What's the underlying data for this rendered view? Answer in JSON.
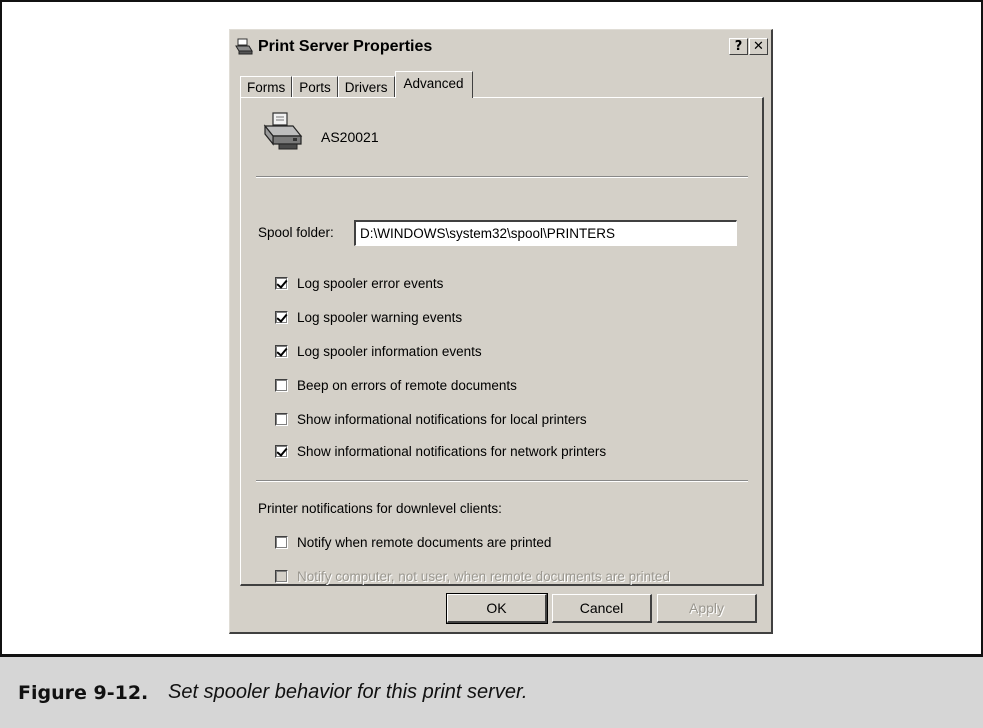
{
  "dialog": {
    "title": "Print Server Properties",
    "help_button": "?",
    "close_button": "✕"
  },
  "tabs": [
    {
      "label": "Forms",
      "active": false
    },
    {
      "label": "Ports",
      "active": false
    },
    {
      "label": "Drivers",
      "active": false
    },
    {
      "label": "Advanced",
      "active": true
    }
  ],
  "server": {
    "icon": "printer-icon",
    "name": "AS20021"
  },
  "spool": {
    "label": "Spool folder:",
    "value": "D:\\WINDOWS\\system32\\spool\\PRINTERS"
  },
  "options": [
    {
      "label": "Log spooler error events",
      "checked": true,
      "enabled": true
    },
    {
      "label": "Log spooler warning events",
      "checked": true,
      "enabled": true
    },
    {
      "label": "Log spooler information events",
      "checked": true,
      "enabled": true
    },
    {
      "label": "Beep on errors of remote documents",
      "checked": false,
      "enabled": true
    },
    {
      "label": "Show informational notifications for local printers",
      "checked": false,
      "enabled": true
    },
    {
      "label": "Show informational notifications for network printers",
      "checked": true,
      "enabled": true
    }
  ],
  "downlevel": {
    "label": "Printer notifications for downlevel clients:",
    "options": [
      {
        "label": "Notify when remote documents are printed",
        "checked": false,
        "enabled": true
      },
      {
        "label": "Notify computer, not user, when remote documents are printed",
        "checked": false,
        "enabled": false
      }
    ]
  },
  "buttons": {
    "ok": "OK",
    "cancel": "Cancel",
    "apply": "Apply"
  },
  "caption": {
    "number": "Figure 9-12.",
    "text": "Set spooler behavior for this print server."
  },
  "colors": {
    "dialog_face": "#d4d0c8",
    "caption_bar": "#d6d6d6"
  }
}
